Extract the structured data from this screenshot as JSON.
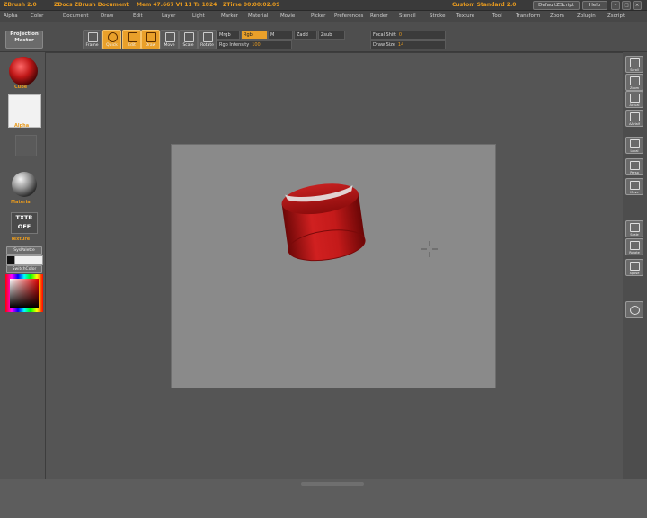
{
  "titlebar": {
    "app": "ZBrush 2.0",
    "doc": "ZDocs ZBrush Document",
    "mem": "Mem 47.667  Vt 11  Ts 1824",
    "timer": "ZTime 00:00:02.09",
    "custom": "Custom  Standard 2.0",
    "default_script": "DefaultZScript",
    "help": "Help"
  },
  "menu": [
    "Alpha",
    "Color",
    "Document",
    "Draw",
    "Edit",
    "Layer",
    "Light",
    "Marker",
    "Material",
    "Movie",
    "Picker",
    "Preferences",
    "Render",
    "Stencil",
    "Stroke",
    "Texture",
    "Tool",
    "Transform",
    "Zoom",
    "Zplugin",
    "Zscript"
  ],
  "shelf": {
    "projection_master": "Projection Master",
    "tools": [
      {
        "label": "Frame",
        "active": false
      },
      {
        "label": "Quick",
        "active": true
      },
      {
        "label": "Edit",
        "active": true
      },
      {
        "label": "Draw",
        "active": true
      },
      {
        "label": "Move",
        "active": false
      },
      {
        "label": "Scale",
        "active": false
      },
      {
        "label": "Rotate",
        "active": false
      }
    ],
    "mrgb": "Mrgb",
    "rgb": "Rgb",
    "m": "M",
    "zadd": "Zadd",
    "zsub": "Zsub",
    "rgb_intensity_label": "Rgb Intensity",
    "rgb_intensity_value": "100",
    "focal_shift_label": "Focal Shift",
    "focal_shift_value": "0",
    "draw_size_label": "Draw Size",
    "draw_size_value": "14"
  },
  "left": {
    "tool_label": "Cube",
    "alpha_label": "Alpha",
    "material_label": "Material",
    "texture_button": "TXTR OFF",
    "texture_label": "Texture",
    "sys_palette": "SysPalette",
    "switch_color": "SwitchColor"
  },
  "right": {
    "buttons": [
      "Scroll",
      "Zoom",
      "Actual",
      "AAHalf",
      "Local",
      "Persp",
      "Move",
      "Scale",
      "Rotate",
      "Xpose",
      ""
    ]
  },
  "colors": {
    "accent": "#e9a02a",
    "cylinder": "#b81818",
    "doc_bg": "#8a8a8a"
  }
}
